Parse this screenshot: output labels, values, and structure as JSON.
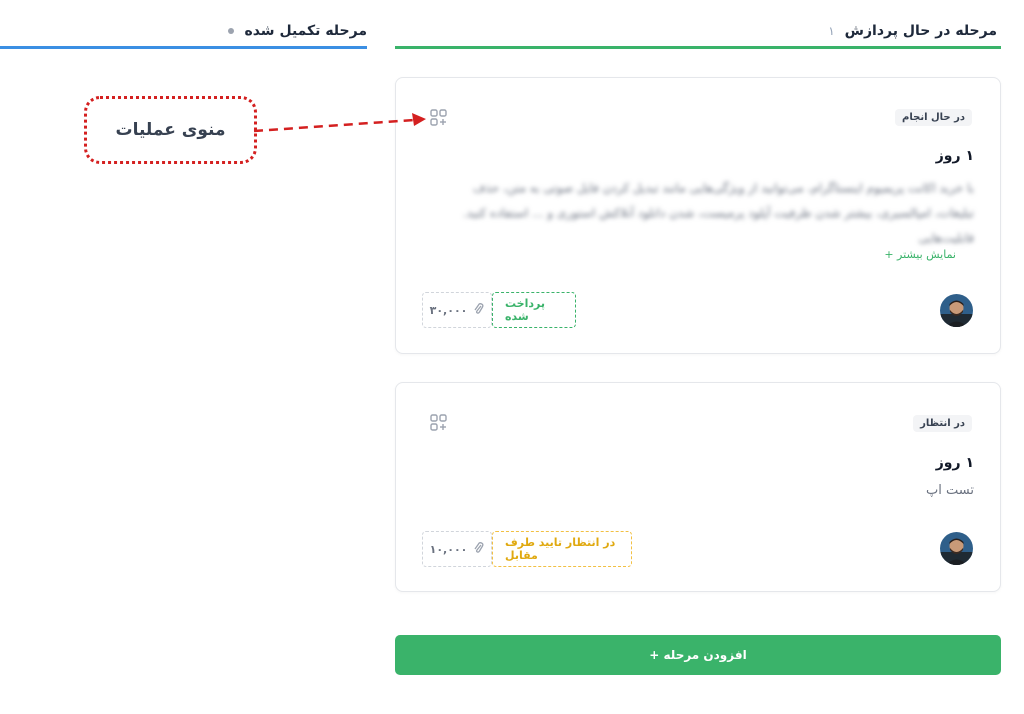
{
  "columns": {
    "processing": {
      "title": "مرحله در حال پردازش",
      "count": "۱"
    },
    "completed": {
      "title": "مرحله تکمیل شده"
    }
  },
  "cards": [
    {
      "status": "در حال انجام",
      "duration": "۱ روز",
      "description": "با خرید اکانت پریمیوم اینستاگرام، می‌توانید از ویژگی‌هایی مانند تبدیل کردن فایل صوتی به متن، حذف تبلیغات، امپالسیری، بیشتر شدن ظرفیت آپلود پرمیست، شدن دانلود آنلاکش استوری و ... استفاده کنید. قابلیت‌هایی",
      "show_more": "نمایش بیشتر +",
      "payment_state": "پرداخت شده",
      "amount": "۳۰,۰۰۰"
    },
    {
      "status": "در انتظار",
      "duration": "۱ روز",
      "description": "تست اپ",
      "payment_state": "در انتظار تایید طرف مقابل",
      "amount": "۱۰,۰۰۰"
    }
  ],
  "add_button": "افزودن مرحله +",
  "annotation": {
    "label": "منوی عملیات"
  },
  "colors": {
    "accent_green": "#3ab36a",
    "accent_blue": "#3b8fe3",
    "warning": "#f2c043",
    "callout_red": "#d42020"
  },
  "icons": {
    "operations": "apps-add-icon",
    "attachment": "paperclip-icon",
    "avatar": "user-avatar"
  }
}
